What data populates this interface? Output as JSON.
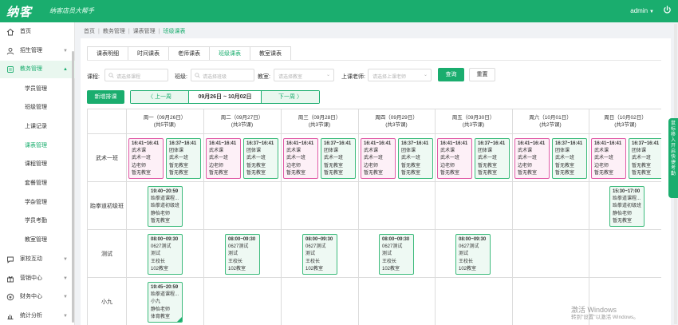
{
  "app": {
    "logo": "纳客",
    "slogan": "纳客店员大帮手",
    "user": "admin",
    "brand_color": "#1aad6e"
  },
  "sidebar": {
    "items": [
      {
        "label": "首页",
        "icon": "home-icon"
      },
      {
        "label": "招生管理",
        "icon": "user-group-icon"
      },
      {
        "label": "教务管理",
        "icon": "book-icon"
      },
      {
        "label": "家校互动",
        "icon": "chat-icon"
      },
      {
        "label": "营销中心",
        "icon": "gift-icon"
      },
      {
        "label": "财务中心",
        "icon": "wallet-icon"
      },
      {
        "label": "统计分析",
        "icon": "chart-icon"
      }
    ],
    "sub_items": [
      "学员管理",
      "班级管理",
      "上课记录",
      "课表管理",
      "课程管理",
      "套餐管理",
      "学杂管理",
      "学员考勤",
      "教室管理"
    ]
  },
  "breadcrumb": [
    "首页",
    "教务管理",
    "课表管理",
    "班级课表"
  ],
  "tabs": [
    "课表明细",
    "时间课表",
    "老师课表",
    "班级课表",
    "教室课表"
  ],
  "filters": {
    "course_label": "课程:",
    "course_placeholder": "请选择课程",
    "class_label": "班级:",
    "class_placeholder": "请选择班级",
    "room_label": "教室:",
    "room_placeholder": "请选择教室",
    "teacher_label": "上课老师:",
    "teacher_placeholder": "请选择上课老师",
    "query": "查询",
    "reset": "重置"
  },
  "toolbar": {
    "add": "新增排课",
    "prev": "〈 上一周",
    "range": "09月26日 ~ 10月02日",
    "next": "下一周 〉"
  },
  "days": [
    {
      "label": "周一（09月26日）",
      "count": "(共5节课)"
    },
    {
      "label": "周二（09月27日）",
      "count": "(共3节课)"
    },
    {
      "label": "周三（09月28日）",
      "count": "(共3节课)"
    },
    {
      "label": "周四（09月29日）",
      "count": "(共3节课)"
    },
    {
      "label": "周五（09月30日）",
      "count": "(共3节课)"
    },
    {
      "label": "周六（10月01日）",
      "count": "(共2节课)"
    },
    {
      "label": "周日（10月02日）",
      "count": "(共3节课)"
    }
  ],
  "rows": [
    "武术一班",
    "跆拳道初级班",
    "测试",
    "小九"
  ],
  "events": {
    "wushu_pink": [
      "16:41~16:41",
      "武术课",
      "武术一班",
      "边老师",
      "暂无教室"
    ],
    "wushu_green": [
      "16:37~16:41",
      "团体课",
      "武术一班",
      "暂无教室",
      "暂无教室"
    ],
    "tkd_mon": [
      "19:40~20:59",
      "跆拳道课程...",
      "跆拳道初级班",
      "静怡老师",
      "暂无教室"
    ],
    "tkd_sun": [
      "15:30~17:00",
      "跆拳道课程...",
      "跆拳道初级班",
      "静怡老师",
      "暂无教室"
    ],
    "test": [
      "08:00~09:30",
      "0627测试",
      "测试",
      "王校长",
      "102教室"
    ],
    "xiaojiu": [
      "19:45~20:59",
      "跆拳道课程...",
      "小九",
      "静怡老师",
      "体育教室"
    ]
  },
  "right_panel": [
    "鼠",
    "标",
    "移",
    "入",
    "开",
    "启",
    "快",
    "捷",
    "考",
    "勤"
  ],
  "watermark": {
    "line1": "激活 Windows",
    "line2": "转到\"设置\"以激活 Windows。"
  }
}
